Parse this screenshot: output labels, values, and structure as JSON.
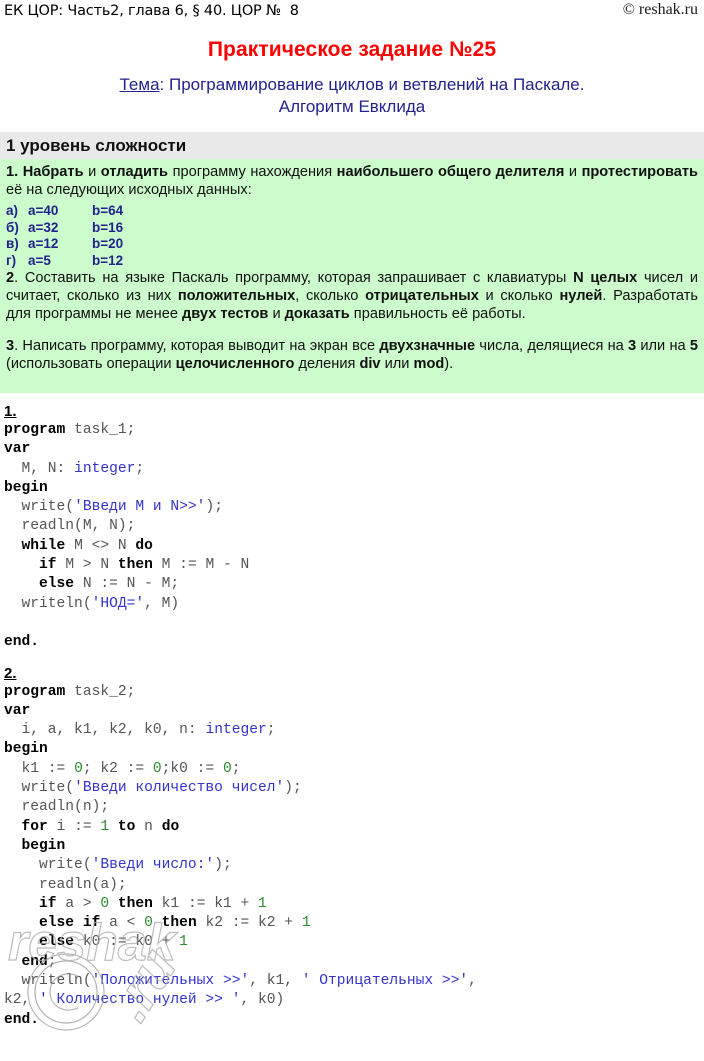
{
  "header": {
    "breadcrumb": "ЕК ЦОР: Часть2, глава 6, § 40. ЦОР №  8",
    "copyright": "© reshak.ru"
  },
  "title": "Практическое задание №25",
  "subject": {
    "label": "Тема",
    "line1": ": Программирование циклов и ветвлений на Паскале.",
    "line2": "Алгоритм Евклида"
  },
  "panel": {
    "heading": "1 уровень сложности",
    "tasks": [
      {
        "number": "1.",
        "html": "<b>1.</b> <b>Набрать</b> и <b>отладить</b> программу нахождения <b>наибольшего общего делителя</b> и <b>протестировать</b> её на следующих исходных данных:"
      },
      {
        "number": "2.",
        "html": "<b>2</b>. Составить на языке Паскаль программу, которая запрашивает с клавиатуры <b>N целых</b> чисел и считает, сколько из них <b>положительных</b>, сколько <b>отрицательных</b> и сколько <b>нулей</b>. Разработать для программы не менее <b>двух тестов</b> и <b>доказать</b> правильность её работы."
      },
      {
        "number": "3.",
        "html": "<b>3</b>. Написать программу, которая выводит на экран все <b>двухзначные</b> числа, делящиеся на <b>3</b> или на <b>5</b> (использовать операции <b>целочисленного</b> деления <b>div</b> или <b>mod</b>)."
      }
    ],
    "test_data": [
      {
        "key": "а)",
        "a": "a=40",
        "b": "b=64"
      },
      {
        "key": "б)",
        "a": "a=32",
        "b": "b=16"
      },
      {
        "key": "в)",
        "a": "a=12",
        "b": "b=20"
      },
      {
        "key": "г)",
        "a": "a=5",
        "b": "b=12"
      }
    ]
  },
  "solutions": [
    {
      "number": "1.",
      "program_name": "task_1",
      "code_html": "<span class=\"kw\">program</span> <span class=\"id\">task_1;</span>\n<span class=\"kw\">var</span>\n  <span class=\"id\">M, N:</span> <span class=\"ty\">integer</span><span class=\"id\">;</span>\n<span class=\"kw\">begin</span>\n  <span class=\"id\">write(</span><span class=\"st\">'Введи M и N&gt;&gt;'</span><span class=\"id\">);</span>\n  <span class=\"id\">readln(M, N);</span>\n  <span class=\"kw\">while</span> <span class=\"id\">M &lt;&gt; N</span> <span class=\"kw\">do</span>\n    <span class=\"kw\">if</span> <span class=\"id\">M &gt; N</span> <span class=\"kw\">then</span> <span class=\"id\">M := M - N</span>\n    <span class=\"kw\">else</span> <span class=\"id\">N := N - M;</span>\n  <span class=\"id\">writeln(</span><span class=\"st\">'НОД='</span><span class=\"id\">, M)</span>\n\n<span class=\"kw\">end.</span>",
      "code_plain": "program task_1;\nvar\n  M, N: integer;\nbegin\n  write('Введи M и N>>');\n  readln(M, N);\n  while M <> N do\n    if M > N then M := M - N\n    else N := N - M;\n  writeln('НОД=', M)\n\nend."
    },
    {
      "number": "2.",
      "program_name": "task_2",
      "code_html": "<span class=\"kw\">program</span> <span class=\"id\">task_2;</span>\n<span class=\"kw\">var</span>\n  <span class=\"id\">i, a, k1, k2, k0, n:</span> <span class=\"ty\">integer</span><span class=\"id\">;</span>\n<span class=\"kw\">begin</span>\n  <span class=\"id\">k1 := </span><span class=\"nu\">0</span><span class=\"id\">; k2 := </span><span class=\"nu\">0</span><span class=\"id\">;k0 := </span><span class=\"nu\">0</span><span class=\"id\">;</span>\n  <span class=\"id\">write(</span><span class=\"st\">'Введи количество чисел'</span><span class=\"id\">);</span>\n  <span class=\"id\">readln(n);</span>\n  <span class=\"kw\">for</span> <span class=\"id\">i := </span><span class=\"nu\">1</span> <span class=\"kw\">to</span> <span class=\"id\">n</span> <span class=\"kw\">do</span>\n  <span class=\"kw\">begin</span>\n    <span class=\"id\">write(</span><span class=\"st\">'Введи число:'</span><span class=\"id\">);</span>\n    <span class=\"id\">readln(a);</span>\n    <span class=\"kw\">if</span> <span class=\"id\">a &gt; </span><span class=\"nu\">0</span> <span class=\"kw\">then</span> <span class=\"id\">k1 := k1 + </span><span class=\"nu\">1</span>\n    <span class=\"kw\">else if</span> <span class=\"id\">a &lt; </span><span class=\"nu\">0</span> <span class=\"kw\">then</span> <span class=\"id\">k2 := k2 + </span><span class=\"nu\">1</span>\n    <span class=\"kw\">else</span> <span class=\"id\">k0 := k0 + </span><span class=\"nu\">1</span>\n  <span class=\"kw\">end</span><span class=\"id\">;</span>\n  <span class=\"id\">writeln(</span><span class=\"st\">'Положительных &gt;&gt;'</span><span class=\"id\">, k1, </span><span class=\"st\">' Отрицательных &gt;&gt;'</span><span class=\"id\">,\nk2, </span><span class=\"st\">' Количество нулей &gt;&gt; '</span><span class=\"id\">, k0)</span>\n<span class=\"kw\">end.</span>",
      "code_plain": "program task_2;\nvar\n  i, a, k1, k2, k0, n: integer;\nbegin\n  k1 := 0; k2 := 0;k0 := 0;\n  write('Введи количество чисел');\n  readln(n);\n  for i := 1 to n do\n  begin\n    write('Введи число:');\n    readln(a);\n    if a > 0 then k1 := k1 + 1\n    else if a < 0 then k2 := k2 + 1\n    else k0 := k0 + 1\n  end;\n  writeln('Положительных >>', k1, ' Отрицательных >>',\nk2, ' Количество нулей >> ', k0)\nend."
    }
  ],
  "watermark": {
    "text": "reshak",
    "symbol": "©"
  },
  "colors": {
    "title": "#ff0000",
    "subject": "#22228c",
    "panel_bg": "#ccfccc",
    "panel_head_bg": "#e9e9e9",
    "code_string": "#3333cc",
    "code_number": "#2e8b2e",
    "code_keyword": "#000000"
  }
}
